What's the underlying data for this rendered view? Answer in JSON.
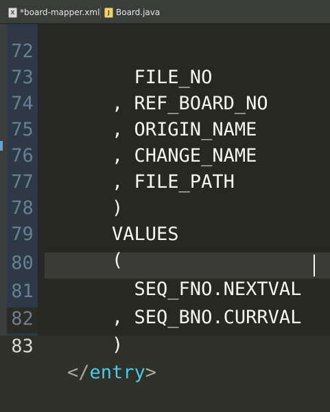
{
  "tabs": [
    {
      "label": "*board-mapper.xml",
      "icon": "xml-file-icon",
      "active": true
    },
    {
      "label": "Board.java",
      "icon": "java-file-icon",
      "active": false
    }
  ],
  "lines": [
    {
      "number": "72",
      "text": "      FILE_NO"
    },
    {
      "number": "73",
      "text": "    , REF_BOARD_NO"
    },
    {
      "number": "74",
      "text": "    , ORIGIN_NAME"
    },
    {
      "number": "75",
      "text": "    , CHANGE_NAME"
    },
    {
      "number": "76",
      "text": "    , FILE_PATH"
    },
    {
      "number": "77",
      "text": "    )"
    },
    {
      "number": "78",
      "text": "    VALUES"
    },
    {
      "number": "79",
      "text": "    ("
    },
    {
      "number": "80",
      "text": "      SEQ_FNO.NEXTVAL"
    },
    {
      "number": "81",
      "text": "    , SEQ_BNO.CURRVAL"
    },
    {
      "number": "82",
      "text": "    )"
    },
    {
      "number": "83",
      "tag_open": "</",
      "tag_name": "entry",
      "tag_close": ">"
    }
  ],
  "colors": {
    "editor_bg": "#272822",
    "gutter_bg": "#2d3a45",
    "keyword": "#4cc8ec",
    "text": "#f8f8f2",
    "line_number": "#6a7f8f"
  }
}
